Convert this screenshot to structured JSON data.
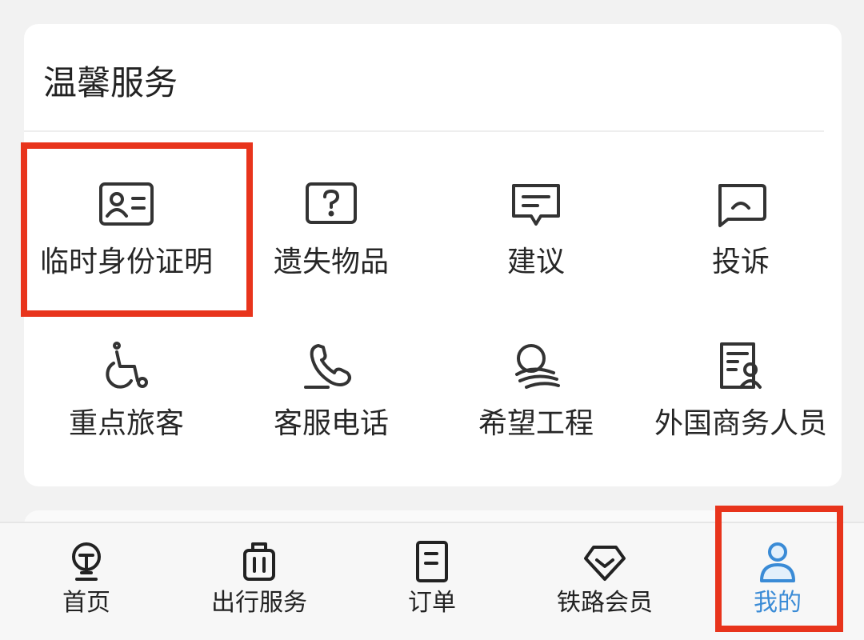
{
  "service_section": {
    "title": "温馨服务",
    "items": [
      {
        "label": "临时身份证明",
        "icon": "id-card-icon"
      },
      {
        "label": "遗失物品",
        "icon": "help-box-icon"
      },
      {
        "label": "建议",
        "icon": "message-lines-icon"
      },
      {
        "label": "投诉",
        "icon": "message-frown-icon"
      },
      {
        "label": "重点旅客",
        "icon": "wheelchair-icon"
      },
      {
        "label": "客服电话",
        "icon": "phone-icon"
      },
      {
        "label": "希望工程",
        "icon": "hope-project-icon"
      },
      {
        "label": "外国商务人员",
        "icon": "document-person-icon"
      }
    ]
  },
  "tabbar": {
    "items": [
      {
        "label": "首页",
        "icon": "railway-logo-icon"
      },
      {
        "label": "出行服务",
        "icon": "luggage-icon"
      },
      {
        "label": "订单",
        "icon": "order-doc-icon"
      },
      {
        "label": "铁路会员",
        "icon": "diamond-icon"
      },
      {
        "label": "我的",
        "icon": "user-icon"
      }
    ],
    "active_index": 4
  },
  "colors": {
    "accent": "#3a8bd6",
    "highlight": "#e8341c",
    "icon": "#333333"
  }
}
